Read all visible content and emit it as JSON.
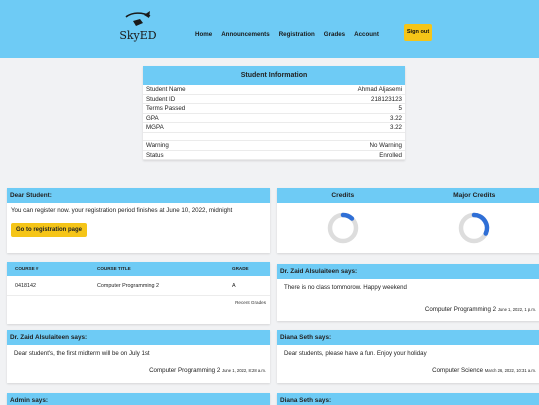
{
  "app": {
    "logo_text": "SkyED"
  },
  "nav": {
    "items": [
      "Home",
      "Announcements",
      "Registration",
      "Grades",
      "Account"
    ],
    "signout": "Sign out"
  },
  "student_info": {
    "title": "Student Information",
    "rows": [
      {
        "label": "Student Name",
        "value": "Ahmad Aljasemi"
      },
      {
        "label": "Student ID",
        "value": "218123123"
      },
      {
        "label": "Terms Passed",
        "value": "5"
      },
      {
        "label": "GPA",
        "value": "3.22"
      },
      {
        "label": "MGPA",
        "value": "3.22"
      },
      {
        "label": "Warning",
        "value": "No Warning"
      },
      {
        "label": "Status",
        "value": "Enrolled"
      }
    ]
  },
  "registration_card": {
    "title": "Dear Student:",
    "message": "You can register now. your registration period finishes at June 10, 2022, midnight",
    "button": "Go to registration page"
  },
  "credits": {
    "labels": [
      "Credits",
      "Major Credits"
    ],
    "progress": [
      0.12,
      0.32
    ]
  },
  "grades": {
    "headers": [
      "COURSE #",
      "COURSE TITLE",
      "GRADE"
    ],
    "rows": [
      {
        "course": "0418142",
        "title": "Computer Programming 2",
        "grade": "A"
      }
    ],
    "footer_link": "Recent Grades"
  },
  "announcements": [
    {
      "author": "Dr. Zaid Alsulaiteen says:",
      "message": "There is no class tommorow. Happy weekend",
      "course": "Computer Programming 2",
      "date": "June 1, 2022, 1 p.m."
    },
    {
      "author": "Dr. Zaid Alsulaiteen says:",
      "message": "Dear student's, the first midterm will be on July 1st",
      "course": "Computer Programming 2",
      "date": "June 1, 2022, 8:28 a.m."
    },
    {
      "author": "Diana Seth says:",
      "message": "Dear students, please have a fun. Enjoy your holiday",
      "course": "Computer Science",
      "date": "March 26, 2022, 10:31 a.m."
    },
    {
      "author": "Admin says:"
    },
    {
      "author": "Diana Seth says:"
    }
  ],
  "colors": {
    "accent": "#6ecbf5",
    "button": "#f5c518",
    "ring": "#2f6fd6",
    "ring_track": "#dddddd"
  }
}
